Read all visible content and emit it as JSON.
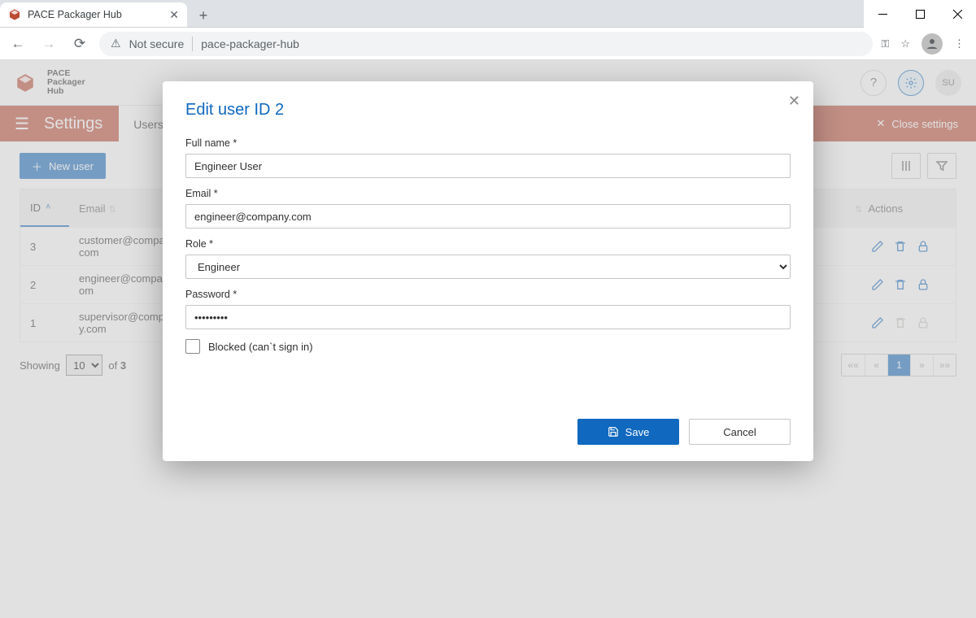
{
  "browser": {
    "tab_title": "PACE Packager Hub",
    "security_label": "Not secure",
    "url": "pace-packager-hub"
  },
  "app": {
    "logo_text_l1": "PACE",
    "logo_text_l2": "Packager",
    "logo_text_l3": "Hub",
    "user_badge": "SU"
  },
  "settings_bar": {
    "title": "Settings",
    "active_tab": "Users",
    "close_label": "Close settings"
  },
  "toolbar": {
    "new_user_label": "New user"
  },
  "table": {
    "headers": {
      "id": "ID",
      "email": "Email",
      "actions": "Actions"
    },
    "rows": [
      {
        "id": "3",
        "email": "customer@company.com",
        "actions_disabled": false
      },
      {
        "id": "2",
        "email": "engineer@company.com",
        "actions_disabled": false
      },
      {
        "id": "1",
        "email": "supervisor@company.com",
        "actions_disabled": true
      }
    ]
  },
  "pager": {
    "showing_label": "Showing",
    "page_size": "10",
    "of_label": "of",
    "total": "3",
    "current": "1",
    "nav": {
      "first": "««",
      "prev": "«",
      "next": "»",
      "last": "»»"
    }
  },
  "modal": {
    "title": "Edit user ID 2",
    "fields": {
      "full_name": {
        "label": "Full name *",
        "value": "Engineer User"
      },
      "email": {
        "label": "Email *",
        "value": "engineer@company.com"
      },
      "role": {
        "label": "Role *",
        "value": "Engineer"
      },
      "password": {
        "label": "Password *",
        "value": "•••••••••"
      },
      "blocked": {
        "label": "Blocked (can`t sign in)",
        "checked": false
      }
    },
    "actions": {
      "save": "Save",
      "cancel": "Cancel"
    }
  }
}
